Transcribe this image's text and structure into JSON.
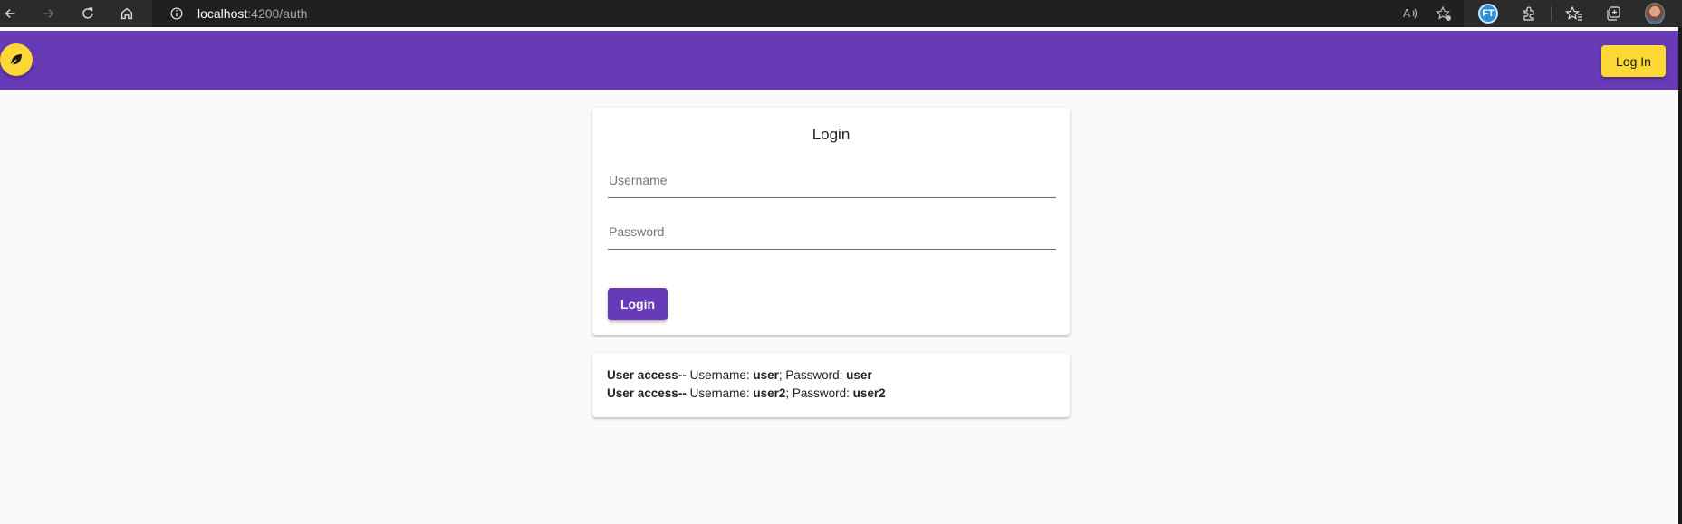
{
  "browser": {
    "url_host": "localhost",
    "url_path": ":4200/auth",
    "profile_badge": "FT"
  },
  "toolbar": {
    "login_label": "Log In",
    "brand_color": "#673ab7",
    "accent_color": "#fdd835"
  },
  "login_card": {
    "title": "Login",
    "username_placeholder": "Username",
    "password_placeholder": "Password",
    "submit_label": "Login"
  },
  "access_info": [
    {
      "prefix": "User access--",
      "username_label": " Username: ",
      "username": "user",
      "password_label": "; Password: ",
      "password": "user"
    },
    {
      "prefix": "User access--",
      "username_label": " Username: ",
      "username": "user2",
      "password_label": "; Password: ",
      "password": "user2"
    }
  ]
}
